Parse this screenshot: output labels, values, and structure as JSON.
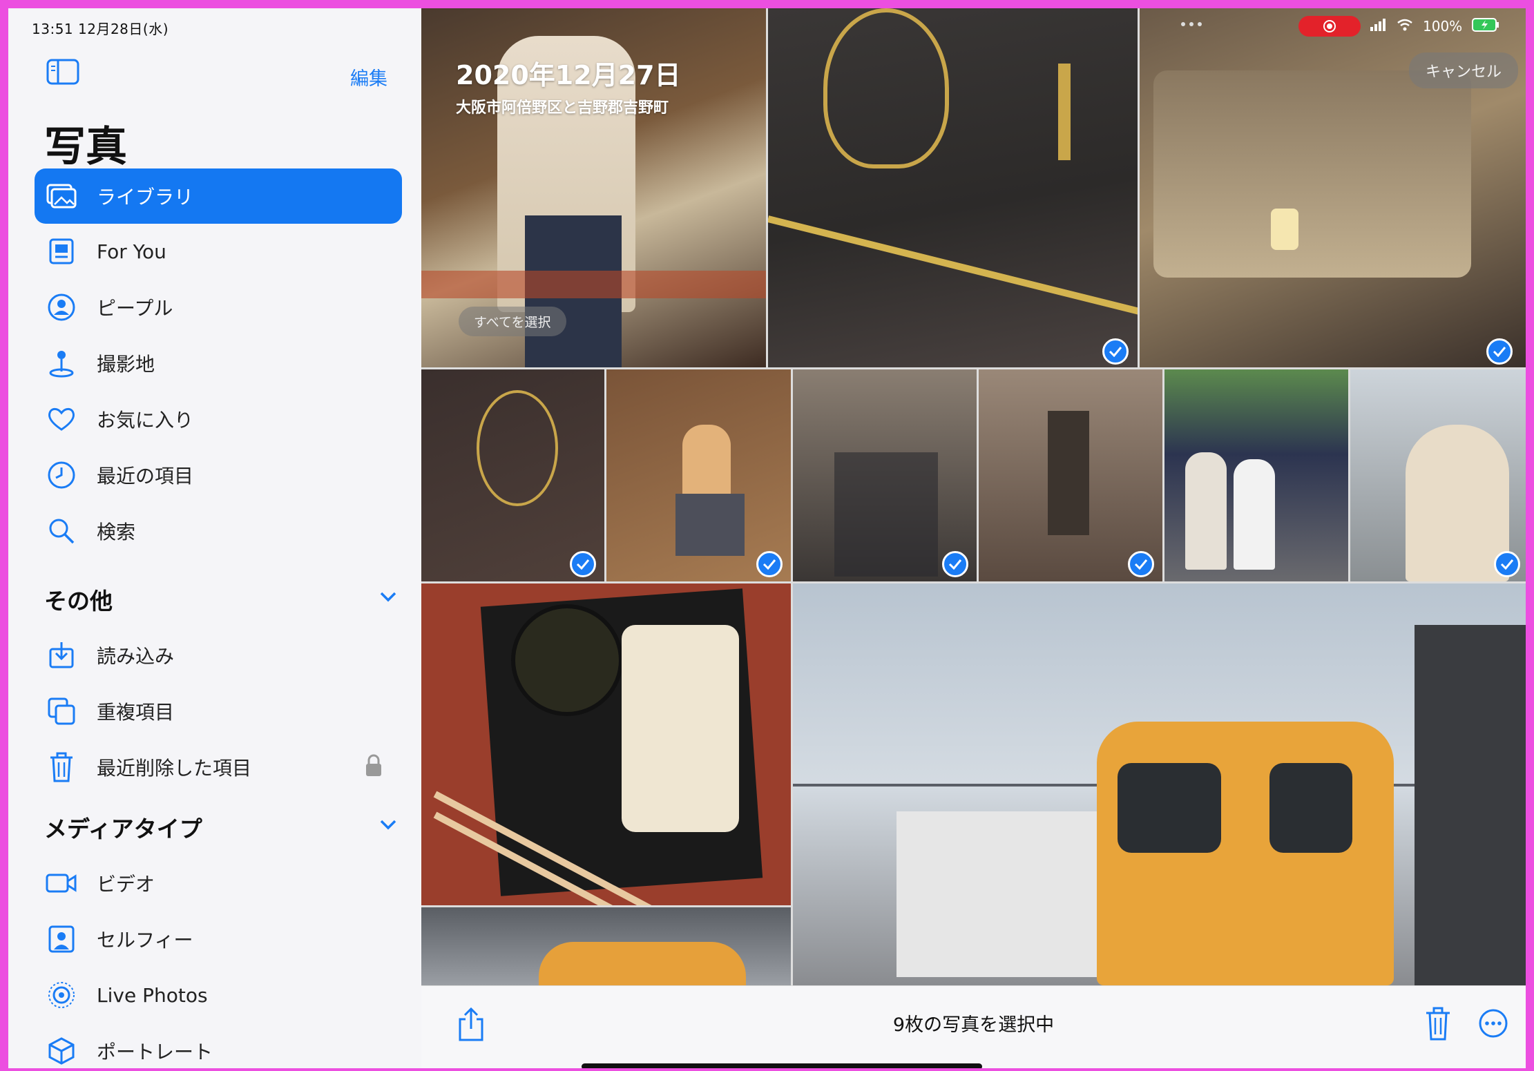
{
  "status_bar": {
    "time_date": "13:51  12月28日(水)",
    "battery": "100%"
  },
  "sidebar": {
    "edit_label": "編集",
    "title": "写真",
    "items": [
      {
        "label": "ライブラリ",
        "icon": "photo-library-icon",
        "selected": true
      },
      {
        "label": "For You",
        "icon": "for-you-icon",
        "selected": false
      },
      {
        "label": "ピープル",
        "icon": "people-icon",
        "selected": false
      },
      {
        "label": "撮影地",
        "icon": "map-pin-icon",
        "selected": false
      },
      {
        "label": "お気に入り",
        "icon": "heart-icon",
        "selected": false
      },
      {
        "label": "最近の項目",
        "icon": "clock-icon",
        "selected": false
      },
      {
        "label": "検索",
        "icon": "search-icon",
        "selected": false
      }
    ],
    "other_section": {
      "title": "その他",
      "items": [
        {
          "label": "読み込み",
          "icon": "import-icon"
        },
        {
          "label": "重複項目",
          "icon": "duplicates-icon"
        },
        {
          "label": "最近削除した項目",
          "icon": "trash-icon"
        }
      ]
    },
    "media_section": {
      "title": "メディアタイプ",
      "items": [
        {
          "label": "ビデオ",
          "icon": "video-icon"
        },
        {
          "label": "セルフィー",
          "icon": "selfie-icon"
        },
        {
          "label": "Live Photos",
          "icon": "live-photo-icon"
        },
        {
          "label": "ポートレート",
          "icon": "portrait-icon"
        }
      ]
    }
  },
  "grid": {
    "date_title": "2020年12月27日",
    "location": "大阪市阿倍野区と吉野郡吉野町",
    "select_all_label": "すべてを選択",
    "cancel_label": "キャンセル"
  },
  "toolbar": {
    "selection_status": "9枚の写真を選択中"
  },
  "colors": {
    "accent": "#1478f2",
    "frame": "#ec4fe0"
  }
}
